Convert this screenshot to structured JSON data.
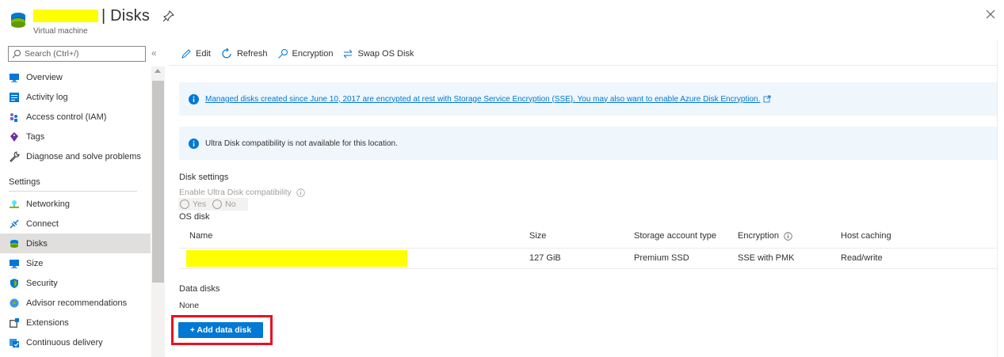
{
  "header": {
    "title": "| Disks",
    "subtitle": "Virtual machine"
  },
  "sidebar": {
    "search_placeholder": "Search (Ctrl+/)",
    "collapse_label": "«",
    "items": [
      {
        "label": "Overview",
        "icon": "monitor-icon"
      },
      {
        "label": "Activity log",
        "icon": "activity-log-icon"
      },
      {
        "label": "Access control (IAM)",
        "icon": "people-icon"
      },
      {
        "label": "Tags",
        "icon": "tag-icon"
      },
      {
        "label": "Diagnose and solve problems",
        "icon": "wrench-icon"
      }
    ],
    "section_settings": "Settings",
    "settings_items": [
      {
        "label": "Networking",
        "icon": "network-icon"
      },
      {
        "label": "Connect",
        "icon": "connect-icon"
      },
      {
        "label": "Disks",
        "icon": "disk-icon",
        "active": true
      },
      {
        "label": "Size",
        "icon": "monitor-icon"
      },
      {
        "label": "Security",
        "icon": "shield-icon"
      },
      {
        "label": "Advisor recommendations",
        "icon": "advisor-icon"
      },
      {
        "label": "Extensions",
        "icon": "extensions-icon"
      },
      {
        "label": "Continuous delivery",
        "icon": "delivery-icon"
      }
    ]
  },
  "toolbar": {
    "edit": "Edit",
    "refresh": "Refresh",
    "encryption": "Encryption",
    "swap": "Swap OS Disk"
  },
  "banners": {
    "encryption_info": "Managed disks created since June 10, 2017 are encrypted at rest with Storage Service Encryption (SSE). You may also want to enable Azure Disk Encryption.",
    "ultra_info": "Ultra Disk compatibility is not available for this location."
  },
  "disk_settings": {
    "heading": "Disk settings",
    "ultra_label": "Enable Ultra Disk compatibility",
    "yes": "Yes",
    "no": "No",
    "os_disk_label": "OS disk"
  },
  "os_table": {
    "columns": [
      "Name",
      "Size",
      "Storage account type",
      "Encryption",
      "Host caching"
    ],
    "row": {
      "size": "127 GiB",
      "storage_type": "Premium SSD",
      "encryption": "SSE with PMK",
      "host_caching": "Read/write"
    }
  },
  "data_disks": {
    "heading": "Data disks",
    "value": "None",
    "add_button": "+ Add data disk"
  },
  "colors": {
    "accent": "#0078d4",
    "highlight_box": "#e81123",
    "redaction": "#ffff00"
  }
}
